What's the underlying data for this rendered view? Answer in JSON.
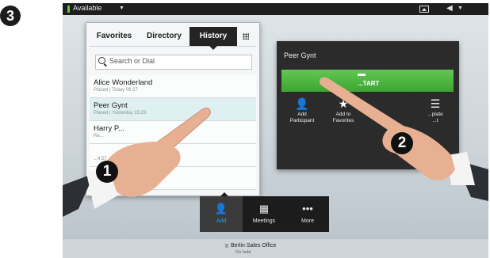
{
  "step_badges": {
    "main": "3",
    "first": "1",
    "second": "2"
  },
  "topbar": {
    "availability": "Available"
  },
  "directory": {
    "tabs": [
      "Favorites",
      "Directory",
      "History"
    ],
    "active_tab": "History",
    "search_placeholder": "Search or Dial",
    "entries": [
      {
        "name": "Alice Wonderland",
        "detail": "Placed | Today 09:27"
      },
      {
        "name": "Peer Gynt",
        "detail": "Placed | Yesterday 15:23"
      },
      {
        "name": "Harry P...",
        "detail": "Re..."
      },
      {
        "name": "",
        "detail": "...4:57"
      },
      {
        "name": "",
        "detail": ""
      }
    ]
  },
  "call_card": {
    "contact": "Peer Gynt",
    "start_label": "...TART",
    "actions": [
      {
        "label1": "Add",
        "label2": "Participant",
        "icon": "add-participant-icon"
      },
      {
        "label1": "Add to",
        "label2": "Favorites",
        "icon": "star-icon"
      },
      {
        "label1": "...plate",
        "label2": "...t",
        "icon": "list-icon"
      }
    ]
  },
  "dock": {
    "items": [
      {
        "label": "Add",
        "icon": "add-contact-icon"
      },
      {
        "label": "Meetings",
        "icon": "calendar-icon"
      },
      {
        "label": "More",
        "icon": "more-icon"
      }
    ]
  },
  "hold_bar": {
    "name": "Berlin Sales Office",
    "status": "On hold"
  },
  "colors": {
    "accent_green": "#4db43f",
    "accent_blue": "#21a8d6",
    "status_green": "#5fcb3a"
  }
}
